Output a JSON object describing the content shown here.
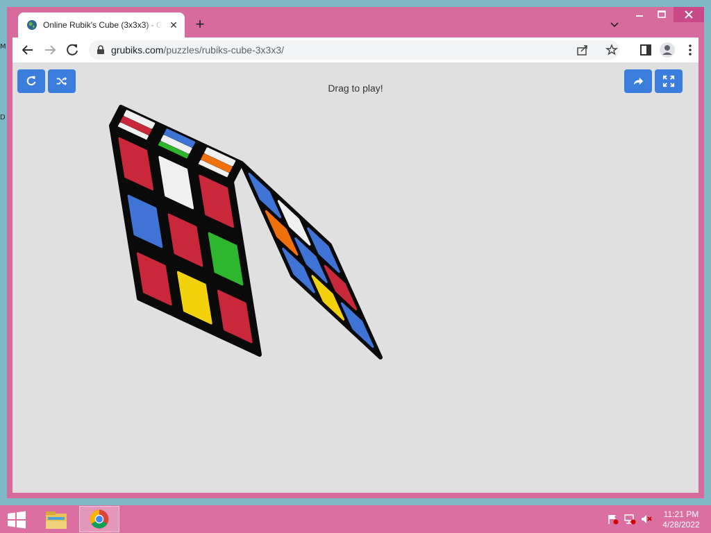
{
  "desktop": {
    "edge_letters": [
      "M",
      "D"
    ]
  },
  "browser": {
    "tab": {
      "title": "Online Rubik's Cube (3x3x3) - Grubiks"
    },
    "address": {
      "domain": "grubiks.com",
      "path": "/puzzles/rubiks-cube-3x3x3/"
    }
  },
  "page": {
    "hint": "Drag to play!",
    "buttons": {
      "reset": "refresh-icon",
      "scramble": "shuffle-icon",
      "share": "share-icon",
      "fullscreen": "fullscreen-icon"
    },
    "cube": {
      "top": [
        "white",
        "orange",
        "white",
        "green",
        "white",
        "blue",
        "white",
        "red",
        "white"
      ],
      "front": [
        "red",
        "white",
        "red",
        "green",
        "red",
        "blue",
        "red",
        "yellow",
        "red"
      ],
      "right": [
        "blue",
        "white",
        "blue",
        "red",
        "blue",
        "orange",
        "blue",
        "yellow",
        "blue"
      ]
    },
    "colors": {
      "white": "#f0f0f0",
      "orange": "#f0700c",
      "green": "#2eb62e",
      "blue": "#3f74d6",
      "red": "#c8283a",
      "yellow": "#f2d20c"
    }
  },
  "taskbar": {
    "time": "11:21 PM",
    "date": "4/28/2022"
  }
}
